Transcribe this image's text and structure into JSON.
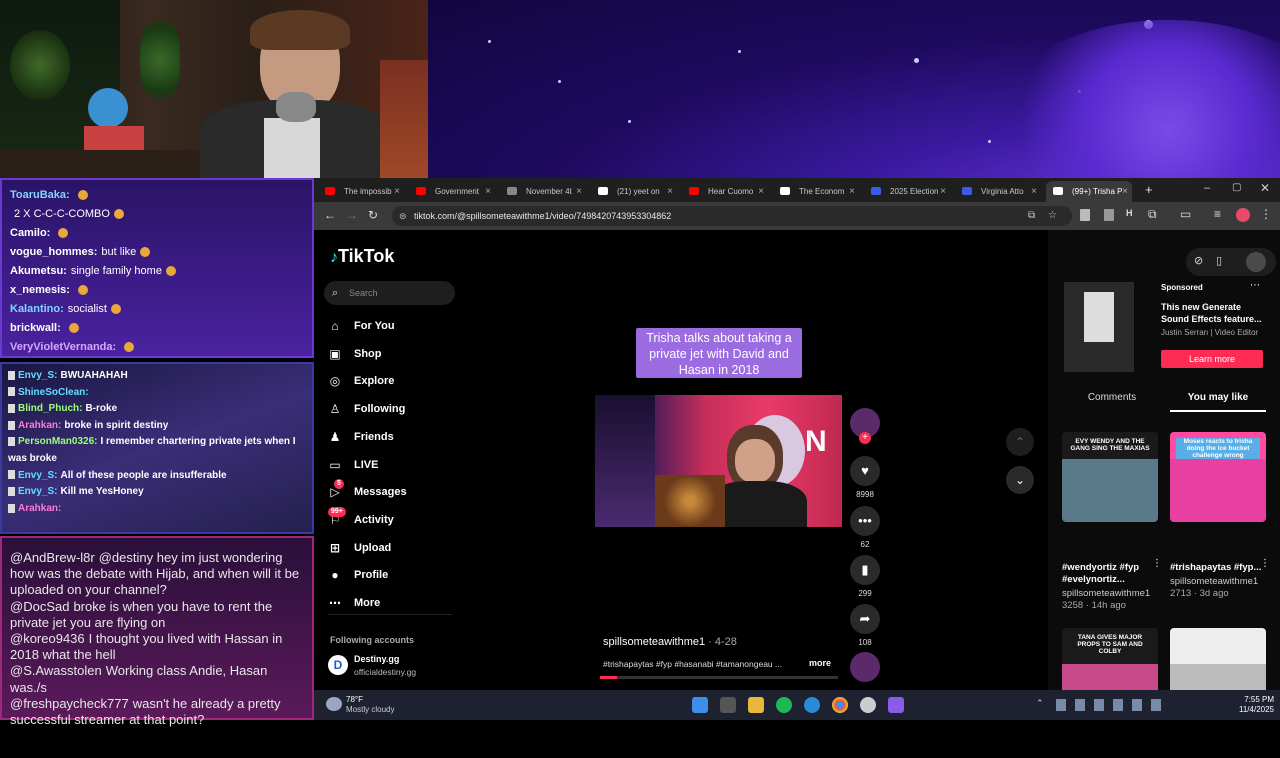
{
  "chat_top": [
    {
      "user": "ToaruBaka:",
      "msg": "",
      "color": "#7fd6ff"
    },
    {
      "user": "",
      "msg": "2 X C-C-C-COMBO",
      "color": "#ffffff"
    },
    {
      "user": "Camilo:",
      "msg": "",
      "color": "#ffffff"
    },
    {
      "user": "vogue_hommes:",
      "msg": "but like",
      "color": "#ffffff"
    },
    {
      "user": "Akumetsu:",
      "msg": "single family home",
      "color": "#ffffff"
    },
    {
      "user": "x_nemesis:",
      "msg": "",
      "color": "#ffffff"
    },
    {
      "user": "Kalantino:",
      "msg": "socialist",
      "color": "#7fd6ff"
    },
    {
      "user": "brickwall:",
      "msg": "",
      "color": "#ffffff"
    },
    {
      "user": "VeryVioletVernanda:",
      "msg": "",
      "color": "#d9a6ff"
    }
  ],
  "chat_mid": [
    {
      "user": "Envy_S:",
      "msg": "BWUAHAHAH",
      "color": "#5fe0ff"
    },
    {
      "user": "ShineSoClean:",
      "msg": "",
      "color": "#5fe0ff"
    },
    {
      "user": "Blind_Phuch:",
      "msg": "B-roke",
      "color": "#9cff7a"
    },
    {
      "user": "Arahkan:",
      "msg": "broke in spirit destiny",
      "color": "#ff7ad9"
    },
    {
      "user": "PersonMan0326:",
      "msg": "I remember chartering private jets when I was broke",
      "color": "#9cff7a"
    },
    {
      "user": "Envy_S:",
      "msg": "All of these people are insufferable",
      "color": "#5fe0ff"
    },
    {
      "user": "Envy_S:",
      "msg": "Kill me YesHoney",
      "color": "#5fe0ff"
    },
    {
      "user": "Arahkan:",
      "msg": "",
      "color": "#ff7ad9"
    }
  ],
  "chat_bottom": [
    {
      "user": "@AndBrew-l8r",
      "msg": "@destiny hey im just wondering how was the debate with Hijab, and when will it be uploaded on your channel?"
    },
    {
      "user": "@DocSad",
      "msg": "broke is when you have to rent the private jet you are flying on"
    },
    {
      "user": "@koreo9436",
      "msg": "I thought you lived with Hassan in 2018 what the hell"
    },
    {
      "user": "@S.Awasstolen",
      "msg": "Working class Andie, Hasan was./s"
    },
    {
      "user": "@freshpaycheck777",
      "msg": "wasn't he already a pretty successful streamer at that point?"
    }
  ],
  "tabs": [
    "The impossib",
    "Government",
    "November 4t",
    "(21) yeet on",
    "Hear Cuomo",
    "The Econom",
    "2025 Election",
    "Virginia Atto",
    "(99+) Trisha P"
  ],
  "url": "tiktok.com/@spillsometeawithme1/video/7498420743953304862",
  "tiktok": {
    "logo": "TikTok",
    "search_placeholder": "Search",
    "nav": [
      "For You",
      "Shop",
      "Explore",
      "Following",
      "Friends",
      "LIVE",
      "Messages",
      "Activity",
      "Upload",
      "Profile",
      "More"
    ],
    "messages_badge": "5",
    "activity_badge": "99+",
    "following_header": "Following accounts",
    "following_name": "Destiny.gg",
    "following_handle": "officialdestiny.gg",
    "caption": "Trisha talks about taking a private jet with David and Hasan in 2018",
    "video_author": "spillsometeawithme1",
    "video_date": "· 4-28",
    "hashtags": "#trishapaytas #fyp #hasanabi #tamanongeau ...",
    "more": "more",
    "likes": "8998",
    "comments": "62",
    "saves": "299",
    "shares": "108"
  },
  "sponsored": {
    "label": "Sponsored",
    "title": "This new Generate Sound Effects feature...",
    "by": "Justin Serran | Video Editor",
    "cta": "Learn more"
  },
  "right_tabs": [
    "Comments",
    "You may like"
  ],
  "cards": [
    {
      "overlay": "EVY WENDY AND THE GANG SING THE MAXIAS",
      "title": "#wendyortiz #fyp #evelynortiz...",
      "author": "spillsometeawithme1",
      "meta": "3258 · 14h ago"
    },
    {
      "overlay": "Moses reacts to trisha doing the ice bucket challenge wrong",
      "title": "#trishapaytas #fyp...",
      "author": "spillsometeawithme1",
      "meta": "2713 · 3d ago"
    },
    {
      "overlay": "TANA GIVES MAJOR PROPS TO SAM AND COLBY",
      "title": "",
      "author": "",
      "meta": ""
    },
    {
      "overlay": "",
      "title": "",
      "author": "",
      "meta": ""
    }
  ],
  "weather": {
    "temp": "78°F",
    "desc": "Mostly cloudy"
  },
  "clock": {
    "time": "7:55 PM",
    "date": "11/4/2025"
  },
  "colors": {
    "accent": "#fe2c55",
    "caption_bg": "#9b6be0"
  }
}
